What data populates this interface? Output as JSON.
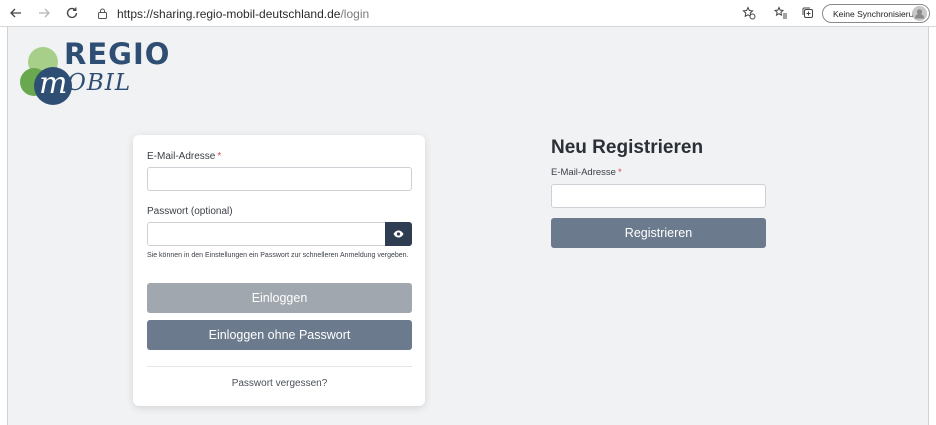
{
  "browser": {
    "url_host": "https://sharing.regio-mobil-deutschland.de",
    "url_path": "/login",
    "sync_label": "Keine Synchronisierung",
    "icons": [
      "back-icon",
      "forward-icon",
      "reload-icon",
      "lock-icon",
      "favorite-add-icon",
      "favorites-icon",
      "collections-icon",
      "profile-icon"
    ]
  },
  "logo": {
    "line1": "REGIO",
    "line2_initial": "m",
    "line2_rest": "OBIL"
  },
  "login": {
    "email_label": "E-Mail-Adresse",
    "required_mark": "*",
    "email_value": "",
    "password_label": "Passwort (optional)",
    "password_value": "",
    "password_hint": "Sie können in den Einstellungen ein Passwort zur schnelleren Anmeldung vergeben.",
    "login_button": "Einloggen",
    "login_no_password_button": "Einloggen ohne Passwort",
    "forgot_password": "Passwort vergessen?"
  },
  "register": {
    "title": "Neu Registrieren",
    "email_label": "E-Mail-Adresse",
    "required_mark": "*",
    "email_value": "",
    "button": "Registrieren"
  },
  "colors": {
    "brand_blue": "#2e4f73",
    "logo_green": "#6aa84f",
    "logo_light_green": "#a8cf8a",
    "button_disabled": "#a1a7ae",
    "button_primary": "#6c7a8e",
    "eye_button": "#2f3d52",
    "required": "#d64545",
    "page_bg": "#f1f2f4"
  }
}
